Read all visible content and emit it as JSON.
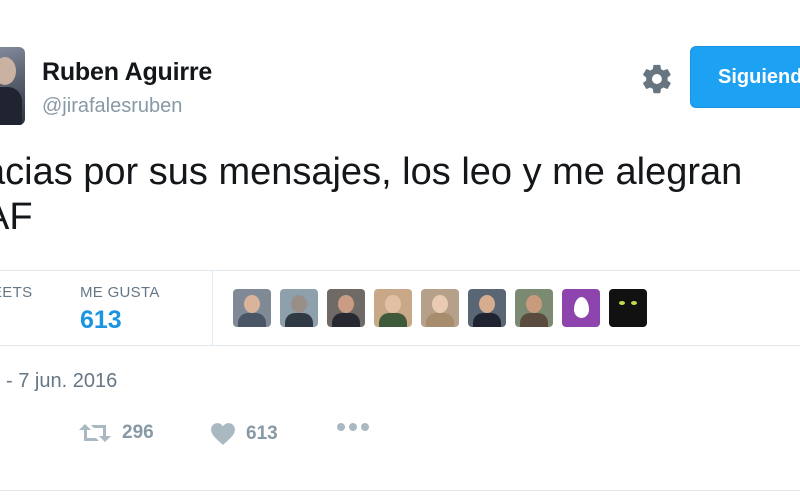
{
  "profile": {
    "name": "Ruben Aguirre",
    "handle": "@jirafalesruben"
  },
  "icons": {
    "settings": "gear-icon",
    "retweet": "retweet-icon",
    "like": "heart-icon",
    "more": "more-icon"
  },
  "header": {
    "follow_label": "Siguiendo"
  },
  "tweet": {
    "line1": "acias por sus mensajes, los leo y me alegran",
    "line2": "AF"
  },
  "stats": {
    "retweets_label": "EETS",
    "likes_label": "ME GUSTA",
    "likes_value": "613"
  },
  "likers": [
    {
      "bg": "#7f8a96",
      "skin": "#d9b49a",
      "shirt": "#4a5666"
    },
    {
      "bg": "#8fa0ad",
      "skin": "#9a8f88",
      "shirt": "#2f3a45"
    },
    {
      "bg": "#6f6a66",
      "skin": "#c99d84",
      "shirt": "#262a30"
    },
    {
      "bg": "#c8a886",
      "skin": "#e2c0a6",
      "shirt": "#3e5a3a"
    },
    {
      "bg": "#b5a08a",
      "skin": "#e8cbb0",
      "shirt": "#a78d6d"
    },
    {
      "bg": "#5a6674",
      "skin": "#d6ad90",
      "shirt": "#1f2430"
    },
    {
      "bg": "#7b8a70",
      "skin": "#c99a7c",
      "shirt": "#5b4a3e"
    },
    {
      "bg": "#8e44ad",
      "skin": "#ffffff",
      "shirt": "#8e44ad",
      "egg": true
    },
    {
      "bg": "#111111",
      "skin": "#111111",
      "shirt": "#111111",
      "cat": true
    }
  ],
  "meta": {
    "date": "- 7 jun. 2016"
  },
  "actions": {
    "retweet_count": "296",
    "like_count": "613"
  },
  "colors": {
    "accent": "#1da1f2",
    "link": "#1b95e0",
    "muted": "#8899a6"
  }
}
